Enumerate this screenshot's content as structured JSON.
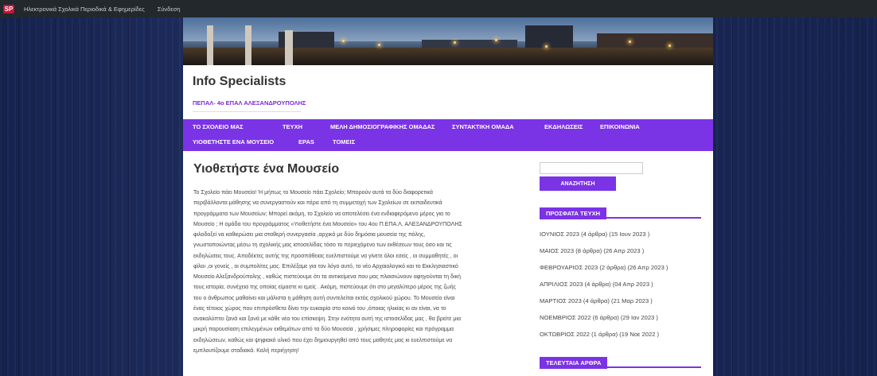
{
  "adminbar": {
    "logo_text": "SP",
    "site_link": "Ηλεκτρονικά Σχολικά Περιοδικά & Εφημερίδες",
    "login": "Σύνδεση"
  },
  "site": {
    "title": "Info Specialists",
    "description": "ΠΕΠΑΛ- 4ο ΕΠΑΛ ΑΛΕΞΑΝΔΡΟΥΠΟΛΗΣ"
  },
  "nav": {
    "items": [
      "ΤΟ ΣΧΟΛΕΙΟ ΜΑΣ",
      "ΤΕΥΧΗ",
      "ΜΕΛΗ ΔΗΜΟΣΙΟΓΡΑΦΙΚΗΣ ΟΜΑΔΑΣ",
      "ΣΥΝΤΑΚΤΙΚΗ ΟΜΑΔΑ",
      "ΕΚΔΗΛΩΣΕΙΣ",
      "ΕΠΙΚΟΙΝΩΝΙΑ",
      "ΥΙΟΘΕΤΗΣΤΕ ΕΝΑ ΜΟΥΣΕΙΟ",
      "EPAS",
      "ΤΟΜΕΙΣ"
    ]
  },
  "post": {
    "title": "Υιοθετήστε ένα Μουσείο",
    "lines": [
      "Το Σχολείο πάει Μουσείο! Ή μήπως το Μουσείο πάει Σχολείο; Μπορούν αυτά τα δύο διαφορετικά",
      "περιβάλλοντα μάθησης να συνεργαστούν και πέρα από τη συμμετοχή των Σχολείων σε εκπαιδευτικά",
      "προγράμματα των Μουσείων; Μπορεί ακόμη, το Σχολείο να αποτελέσει ένα ενδιαφερόμενο μέρος για το",
      "Μουσείο ; Η ομάδα του προγράμματος «Υιοθετήστε ένα Μουσείο» του 4ου Π.ΕΠΑ.Λ. ΑΛΕΞΑΝΔΡΟΥΠΟΛΗΣ",
      "φιλοδοξεί να καθιερώσει μια σταθερή συνεργασία ,αρχικά με δύο δημόσια μουσεία της πόλης,",
      "γνωστοποιώντας μέσω τη σχολικής μας ιστοσελίδας τόσο το περιεχόμενο των εκθέσεων τους όσο και τις",
      "εκδηλώσεις τους. Αποδέκτες αυτής της προσπάθειας ευελπιστούμε να γίνετε όλοι εσείς , οι συμμαθητές , οι",
      "φίλοι ,οι γονείς , οι συμπολίτες μας. Επιλέξαμε για τον λόγο αυτό, το νέο Αρχαιολογικό και το Εκκλησιαστικό",
      "Μουσείο Αλεξανδρούπολης , καθώς πιστεύουμε ότι τα αντικείμενα που μας πλαισιώνουν αφηγούνται τη δική",
      "τους ιστορία, συνέχεια της οποίας είμαστε κι εμείς . Ακόμη, πιστεύουμε ότι στο μεγαλύτερο μέρος της ζωής",
      "του ο άνθρωπος μαθαίνει και μάλιστα η μάθηση αυτή συντελείται εκτός σχολικού χώρου. Το Μουσείο είναι",
      "ένας τέτοιος χώρος που επιπρόσθετα δίνει την ευκαιρία στο κοινό του ,όποιας ηλικίας κι αν είναι, να το",
      "ανακαλύπτει ξανά και ξανά με κάθε νέα του επίσκεψη. Στην ενότητα αυτή της ιστοσελίδας μας , θα βρείτε μια",
      "μικρή παρουσίαση επιλεγμένων εκθεμάτων από τα δύο Μουσεία , χρήσιμες πληροφορίες και πρόγραμμα",
      "εκδηλώσεων, καθώς και ψηφιακό υλικό που έχει δημιουργηθεί από τους μαθητές μας κι ευελπιστούμε να",
      "εμπλουτίζουμε σταδιακά. Καλή περιήγηση!"
    ]
  },
  "sidebar": {
    "search_button": "ΑΝΑΖΗΤΗΣΗ",
    "recent_issues_title": "ΠΡΟΣΦΑΤΑ ΤΕΥΧΗ",
    "recent_issues": [
      "ΙΟΥΝΙΟΣ 2023 (4 άρθρα) (15 Ιουν 2023 )",
      "ΜΑΙΟΣ 2023 (8 άρθρα) (26 Απρ 2023 )",
      "ΦΕΒΡΟΥΑΡΙΟΣ 2023 (2 άρθρα) (26 Απρ 2023 )",
      "ΑΠΡΙΛΙΟΣ 2023 (4 άρθρα) (04 Απρ 2023 )",
      "ΜΑΡΤΙΟΣ 2023 (4 άρθρα) (21 Μαρ 2023 )",
      "ΝΟΕΜΒΡΙΟΣ 2022 (6 άρθρα) (29 Ιαν 2023 )",
      "ΟΚΤΩΒΡΙΟΣ 2022 (1 άρθρα) (19 Νοε 2022 )"
    ],
    "latest_articles_title": "ΤΕΛΕΥΤΑΙΑ ΑΡΘΡΑ"
  }
}
